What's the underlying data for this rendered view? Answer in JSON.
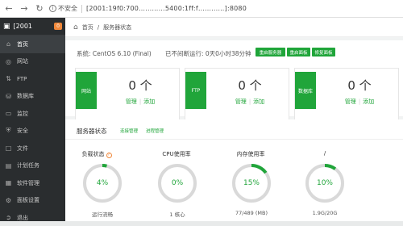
{
  "browser": {
    "security_text": "不安全",
    "url": "[2001:19f0:700…………5400:1ff:f…………]:8080"
  },
  "sidebar": {
    "title": "[2001",
    "badge": "0",
    "items": [
      {
        "label": "首页",
        "icon": "home-icon"
      },
      {
        "label": "网站",
        "icon": "globe-icon"
      },
      {
        "label": "FTP",
        "icon": "ftp-icon"
      },
      {
        "label": "数据库",
        "icon": "database-icon"
      },
      {
        "label": "监控",
        "icon": "monitor-icon"
      },
      {
        "label": "安全",
        "icon": "shield-icon"
      },
      {
        "label": "文件",
        "icon": "folder-icon"
      },
      {
        "label": "计划任务",
        "icon": "calendar-icon"
      },
      {
        "label": "软件管理",
        "icon": "apps-icon"
      },
      {
        "label": "面板设置",
        "icon": "settings-icon"
      },
      {
        "label": "退出",
        "icon": "logout-icon"
      }
    ]
  },
  "breadcrumb": {
    "home": "首页",
    "separator": "/",
    "current": "服务器状态"
  },
  "system": {
    "os": "系统: CentOS 6.10 (Final)",
    "uptime": "已不间断运行: 0天0小时38分钟",
    "buttons": [
      "重启服务器",
      "重启面板",
      "修复面板"
    ]
  },
  "stats": [
    {
      "tag": "网站",
      "value": "0 个",
      "manage": "管理",
      "add": "添加"
    },
    {
      "tag": "FTP",
      "value": "0 个",
      "manage": "管理",
      "add": "添加"
    },
    {
      "tag": "数据库",
      "value": "0 个",
      "manage": "管理",
      "add": "添加"
    }
  ],
  "status": {
    "title": "服务器状态",
    "links": [
      "连接管理",
      "进程管理"
    ],
    "gauges": [
      {
        "label": "负载状态",
        "has_help": true,
        "value": "4%",
        "percent": 4,
        "sub": "运行流畅"
      },
      {
        "label": "CPU使用率",
        "has_help": false,
        "value": "0%",
        "percent": 0,
        "sub": "1 核心"
      },
      {
        "label": "内存使用率",
        "has_help": false,
        "value": "15%",
        "percent": 15,
        "sub": "77/489 (MB)"
      },
      {
        "label": "/",
        "has_help": false,
        "value": "10%",
        "percent": 10,
        "sub": "1.9G/20G"
      }
    ]
  },
  "colors": {
    "accent": "#20a53a",
    "sidebar_bg": "#2a2d2f",
    "gauge_track": "#d9d9d9",
    "warning": "#f0883a"
  }
}
